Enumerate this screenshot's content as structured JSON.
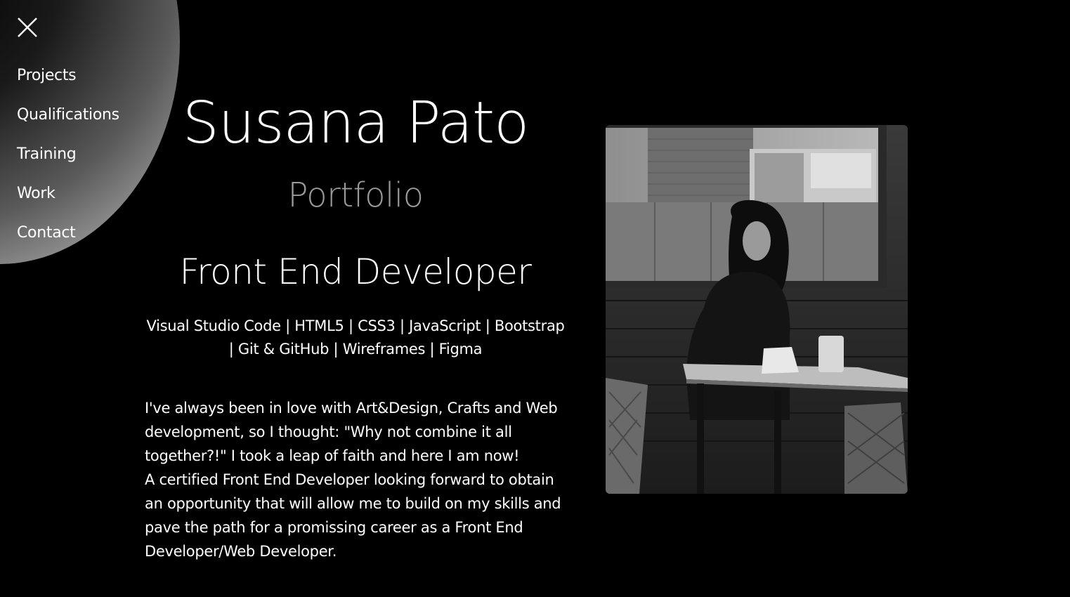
{
  "nav": {
    "close_icon": "close-icon",
    "items": [
      {
        "label": "Projects"
      },
      {
        "label": "Qualifications"
      },
      {
        "label": "Training"
      },
      {
        "label": "Work"
      },
      {
        "label": "Contact"
      }
    ]
  },
  "intro": {
    "name": "Susana Pato",
    "subtitle": "Portfolio",
    "role": "Front End Developer",
    "skills": "Visual Studio Code | HTML5 | CSS3 | JavaScript | Bootstrap | Git & GitHub | Wireframes | Figma",
    "about_1": "I've always been in love with Art&Design, Crafts and Web development, so I thought: \"Why not combine it all together?!\" I took a leap of faith and here I am now!",
    "about_2": "A certified Front End Developer looking forward to obtain an opportunity that will allow me to build on my skills and pave the path for a promissing career as a Front End Developer/Web Developer."
  },
  "colors": {
    "background": "#000000",
    "text": "#ffffff",
    "subtitle": "#9a9a9a"
  }
}
